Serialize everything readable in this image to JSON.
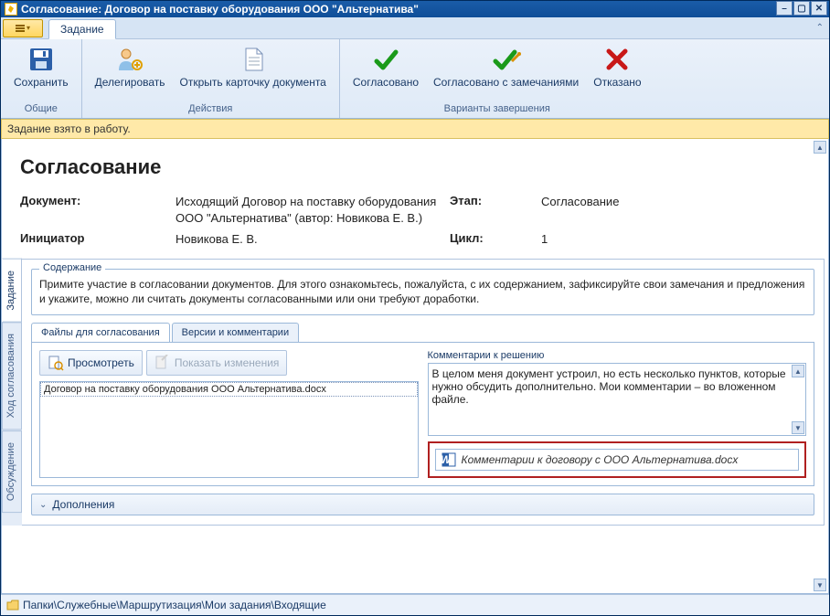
{
  "window": {
    "title": "Согласование: Договор на поставку оборудования ООО \"Альтернатива\""
  },
  "ribbon": {
    "tab": "Задание",
    "groups": {
      "common": {
        "label": "Общие",
        "save": "Сохранить"
      },
      "actions": {
        "label": "Действия",
        "delegate": "Делегировать",
        "open_card": "Открыть карточку документа"
      },
      "completion": {
        "label": "Варианты завершения",
        "approved": "Согласовано",
        "approved_notes": "Согласовано с замечаниями",
        "rejected": "Отказано"
      }
    }
  },
  "status": "Задание взято в работу.",
  "header": {
    "title": "Согласование",
    "doc_label": "Документ:",
    "doc_value": "Исходящий Договор на поставку оборудования ООО \"Альтернатива\" (автор: Новикова Е. В.)",
    "stage_label": "Этап:",
    "stage_value": "Согласование",
    "initiator_label": "Инициатор",
    "initiator_value": "Новикова Е. В.",
    "cycle_label": "Цикл:",
    "cycle_value": "1"
  },
  "side_tabs": {
    "task": "Задание",
    "flow": "Ход согласования",
    "discussion": "Обсуждение"
  },
  "content_group": {
    "title": "Содержание",
    "text": "Примите участие в согласовании документов. Для этого ознакомьтесь, пожалуйста, с их содержанием, зафиксируйте свои замечания и предложения и укажите, можно ли считать документы согласованными или они требуют доработки."
  },
  "inner_tabs": {
    "files": "Файлы для согласования",
    "versions": "Версии и комментарии"
  },
  "toolbar": {
    "preview": "Просмотреть",
    "show_changes": "Показать изменения"
  },
  "files": {
    "row0": "Договор на поставку оборудования ООО Альтернатива.docx"
  },
  "comments": {
    "title": "Комментарии к решению",
    "text": "В целом меня документ устроил, но есть несколько пунктов, которые нужно обсудить дополнительно. Мои комментарии – во вложенном файле.",
    "attachment": "Комментарии к договору с ООО Альтернатива.docx"
  },
  "expander": {
    "label": "Дополнения"
  },
  "breadcrumb": {
    "path": "Папки\\Служебные\\Маршрутизация\\Мои задания\\Входящие"
  }
}
